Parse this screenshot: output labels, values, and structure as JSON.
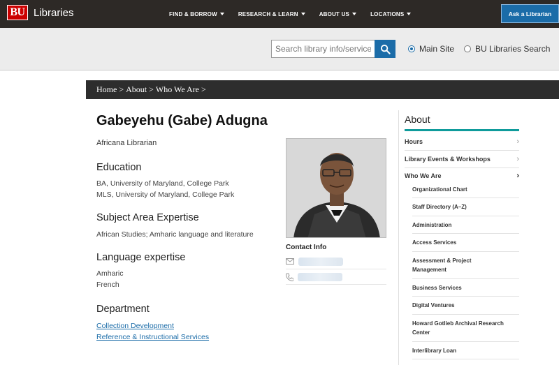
{
  "header": {
    "logo_mark": "BU",
    "logo_text": "Libraries",
    "nav": [
      {
        "label": "FIND & BORROW"
      },
      {
        "label": "RESEARCH & LEARN"
      },
      {
        "label": "ABOUT US"
      },
      {
        "label": "LOCATIONS"
      }
    ],
    "ask_label": "Ask a Librarian"
  },
  "search": {
    "placeholder": "Search library info/services",
    "options": [
      {
        "label": "Main Site",
        "selected": true
      },
      {
        "label": "BU Libraries Search",
        "selected": false
      }
    ]
  },
  "breadcrumb": [
    "Home >",
    "About >",
    "Who We Are >"
  ],
  "profile": {
    "name": "Gabeyehu (Gabe) Adugna",
    "title": "Africana Librarian",
    "education_heading": "Education",
    "education": [
      "BA, University of Maryland, College Park",
      "MLS, University of Maryland, College Park"
    ],
    "expertise_heading": "Subject Area Expertise",
    "expertise": "African Studies; Amharic language and literature",
    "language_heading": "Language expertise",
    "languages": [
      "Amharic",
      "French"
    ],
    "department_heading": "Department",
    "departments": [
      "Collection Development",
      "Reference & Instructional Services"
    ],
    "contact_heading": "Contact Info"
  },
  "sidebar": {
    "title": "About",
    "items": [
      {
        "label": "Hours"
      },
      {
        "label": "Library Events & Workshops"
      },
      {
        "label": "Who We Are"
      }
    ],
    "subitems": [
      {
        "label": "Organizational Chart"
      },
      {
        "label": "Staff Directory (A–Z)"
      },
      {
        "label": "Administration"
      },
      {
        "label": "Access Services"
      },
      {
        "label": "Assessment & Project Management"
      },
      {
        "label": "Business Services"
      },
      {
        "label": "Digital Ventures"
      },
      {
        "label": "Howard Gotlieb Archival Research Center"
      },
      {
        "label": "Interlibrary Loan"
      }
    ]
  },
  "colors": {
    "brand_red": "#cc0000",
    "accent_blue": "#1b6ca8",
    "teal": "#0f9b9b",
    "dark": "#2d2926"
  }
}
